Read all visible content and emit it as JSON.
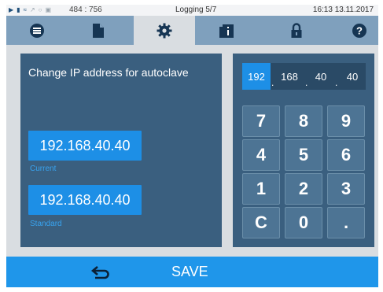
{
  "statusbar": {
    "icons": [
      "play-icon",
      "file-icon",
      "heating-icon",
      "chart-icon",
      "clock-icon",
      "lock-icon"
    ],
    "coords": "484 : 756",
    "center": "Logging 5/7",
    "datetime": "16:13  13.11.2017"
  },
  "tabs": [
    {
      "name": "menu",
      "icon": "list-icon"
    },
    {
      "name": "document",
      "icon": "document-icon"
    },
    {
      "name": "settings",
      "icon": "gear-icon",
      "active": true
    },
    {
      "name": "info",
      "icon": "info-icon"
    },
    {
      "name": "lock",
      "icon": "lock-icon"
    },
    {
      "name": "help",
      "icon": "help-icon"
    }
  ],
  "panel": {
    "title": "Change IP address for autoclave",
    "current_ip": "192.168.40.40",
    "current_label": "Current",
    "standard_ip": "192.168.40.40",
    "standard_label": "Standard"
  },
  "ip_input": {
    "octets": [
      "192",
      "168",
      "40",
      "40"
    ],
    "selected_index": 0,
    "separator": "."
  },
  "keypad": {
    "keys": [
      "7",
      "8",
      "9",
      "4",
      "5",
      "6",
      "1",
      "2",
      "3",
      "C",
      "0",
      "."
    ]
  },
  "bottom": {
    "back_icon": "back-arrow-icon",
    "save_label": "SAVE"
  },
  "colors": {
    "accent": "#1d8fe6",
    "panel": "#3a5f7f",
    "tabbar": "#7fa0bd",
    "key": "#4d7494",
    "bottombar": "#1f96ea"
  }
}
